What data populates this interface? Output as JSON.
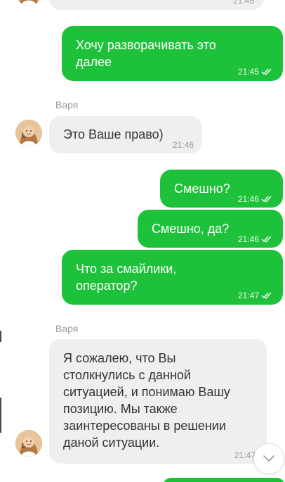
{
  "colors": {
    "outgoing_bubble": "#1ec23a",
    "incoming_bubble": "#efeff1",
    "meta_text": "#9a9a9a"
  },
  "messages": [
    {
      "direction": "in",
      "text": "",
      "time": "21:45"
    },
    {
      "direction": "out",
      "text": "Хочу разворачивать это далее",
      "time": "21:45",
      "status_icon": "double-check-icon"
    },
    {
      "direction": "in",
      "sender": "Варя",
      "text": "Это Ваше право)",
      "time": "21:46",
      "avatar_icon": "operator-avatar-icon"
    },
    {
      "direction": "out",
      "text": "Смешно?",
      "time": "21:46",
      "status_icon": "double-check-icon"
    },
    {
      "direction": "out",
      "text": "Смешно, да?",
      "time": "21:46",
      "status_icon": "double-check-icon"
    },
    {
      "direction": "out",
      "text": "Что за смайлики, оператор?",
      "time": "21:47",
      "status_icon": "double-check-icon"
    },
    {
      "direction": "in",
      "sender": "Варя",
      "text": "Я сожалею, что Вы столкнулись с данной ситуацией, и понимаю Вашу позицию. Мы также заинтересованы в решении даной ситуации.",
      "time": "21:47",
      "avatar_icon": "operator-avatar-icon"
    }
  ],
  "scroll_button": {
    "icon": "chevron-down-icon"
  }
}
